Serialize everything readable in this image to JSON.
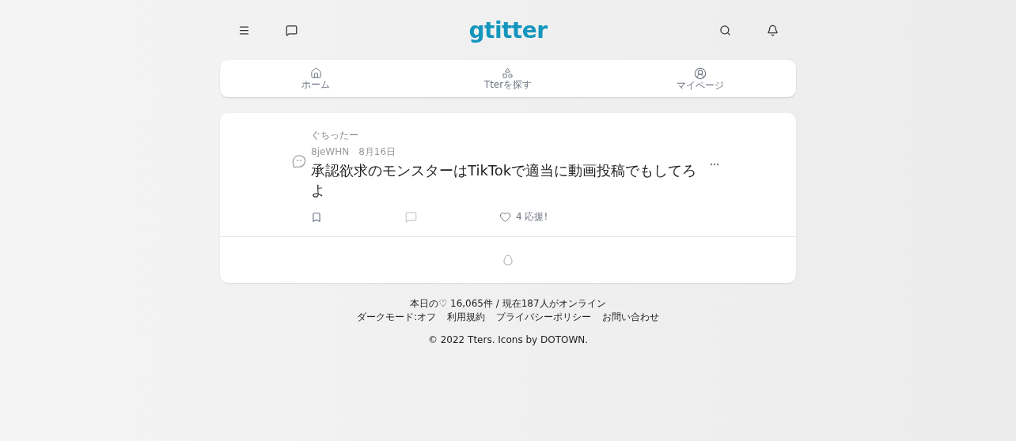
{
  "header": {
    "logo": "gtitter"
  },
  "nav": [
    {
      "kind": "home",
      "label": "ホーム"
    },
    {
      "kind": "explore",
      "label": "Tterを探す"
    },
    {
      "kind": "profile",
      "label": "マイページ"
    }
  ],
  "post": {
    "name": "ぐちったー",
    "user_id": "8jeWHN",
    "date": "8月16日",
    "text": "承認欲求のモンスターはTikTokで適当に動画投稿でもしてろよ",
    "cheer_count": "4",
    "cheer_label": "応援!"
  },
  "footer": {
    "stats": "本日の♡ 16,065件 / 現在187人がオンライン",
    "links": [
      "ダークモード:オフ",
      "利用規約",
      "プライバシーポリシー",
      "お問い合わせ"
    ],
    "copyright": "© 2022 Tters. Icons by DOTOWN."
  }
}
